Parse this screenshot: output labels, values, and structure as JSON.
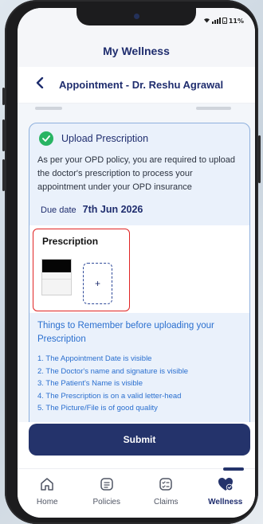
{
  "status": {
    "battery": "11%"
  },
  "app": {
    "title": "My Wellness"
  },
  "subheader": {
    "title": "Appointment - Dr. Reshu Agrawal"
  },
  "upload": {
    "title": "Upload Prescription",
    "policy_text": "As per your OPD policy, you are required to upload the doctor's prescription to process your appointment under your OPD insurance",
    "due_label": "Due date",
    "due_value": "7th Jun 2026",
    "prescription_label": "Prescription",
    "add_symbol": "+"
  },
  "things": {
    "title": "Things to Remember before uploading your Prescription",
    "rules": [
      "1. The Appointment Date is visible",
      "2. The Doctor's name and signature is visible",
      "3. The Patient's Name is visible",
      "4. The Prescription is on a valid letter-head",
      "5. The Picture/File is of good quality"
    ]
  },
  "submit": {
    "label": "Submit"
  },
  "tabs": [
    {
      "label": "Home",
      "icon": "home-icon"
    },
    {
      "label": "Policies",
      "icon": "policy-document-icon"
    },
    {
      "label": "Claims",
      "icon": "claims-list-icon"
    },
    {
      "label": "Wellness",
      "icon": "wellness-heart-icon",
      "active": true
    }
  ],
  "colors": {
    "primary": "#24336b",
    "accent_blue": "#2a6fcf",
    "success": "#28b463",
    "highlight_red": "#e02424"
  }
}
